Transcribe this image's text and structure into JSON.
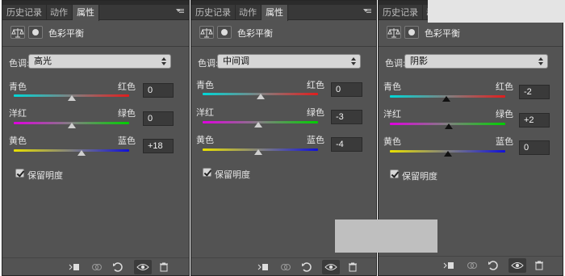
{
  "tabs": [
    "历史记录",
    "动作",
    "属性"
  ],
  "panel_title": "色彩平衡",
  "tone_label": "色调:",
  "preserve_luminosity_label": "保留明度",
  "slider_labels": {
    "cyan": "青色",
    "red": "红色",
    "magenta": "洋红",
    "green": "绿色",
    "yellow": "黄色",
    "blue": "蓝色"
  },
  "panels": [
    {
      "tone": "高光",
      "cyan_red": "0",
      "magenta_green": "0",
      "yellow_blue": "+18",
      "levels": {
        "cyan_red": 0,
        "magenta_green": 0,
        "yellow_blue": 18
      }
    },
    {
      "tone": "中间调",
      "cyan_red": "0",
      "magenta_green": "-3",
      "yellow_blue": "-4",
      "levels": {
        "cyan_red": 0,
        "magenta_green": -3,
        "yellow_blue": -4
      }
    },
    {
      "tone": "阴影",
      "cyan_red": "-2",
      "magenta_green": "+2",
      "yellow_blue": "0",
      "levels": {
        "cyan_red": -2,
        "magenta_green": 2,
        "yellow_blue": 0
      }
    }
  ],
  "icons": [
    "balance-icon",
    "layer-mask-icon",
    "clip-to-layer-icon",
    "view-previous-state-icon",
    "reset-icon",
    "visibility-eye-icon",
    "delete-trash-icon",
    "panel-menu-icon",
    "checkbox-check-icon",
    "select-updown-icon"
  ]
}
